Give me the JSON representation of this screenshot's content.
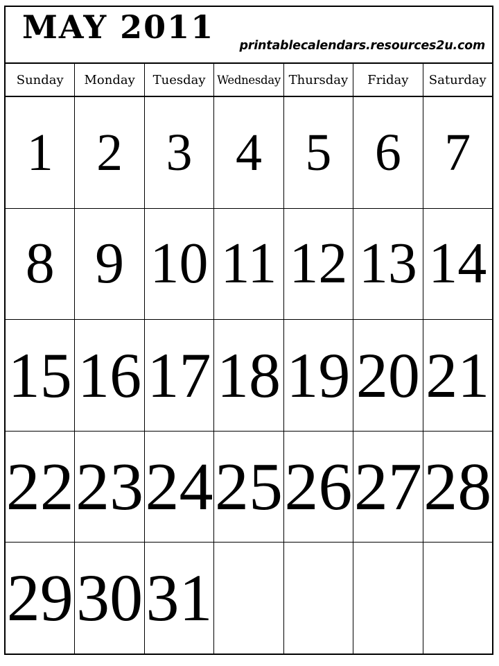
{
  "header": {
    "month_title": "MAY 2011",
    "site_url": "printablecalendars.resources2u.com"
  },
  "weekdays": [
    {
      "label": "Sunday"
    },
    {
      "label": "Monday"
    },
    {
      "label": "Tuesday"
    },
    {
      "label": "Wednesday"
    },
    {
      "label": "Thursday"
    },
    {
      "label": "Friday"
    },
    {
      "label": "Saturday"
    }
  ],
  "weeks": [
    {
      "days": [
        {
          "number": "1"
        },
        {
          "number": "2"
        },
        {
          "number": "3"
        },
        {
          "number": "4"
        },
        {
          "number": "5"
        },
        {
          "number": "6"
        },
        {
          "number": "7"
        }
      ]
    },
    {
      "days": [
        {
          "number": "8"
        },
        {
          "number": "9"
        },
        {
          "number": "10"
        },
        {
          "number": "11"
        },
        {
          "number": "12"
        },
        {
          "number": "13"
        },
        {
          "number": "14"
        }
      ]
    },
    {
      "days": [
        {
          "number": "15"
        },
        {
          "number": "16"
        },
        {
          "number": "17"
        },
        {
          "number": "18"
        },
        {
          "number": "19"
        },
        {
          "number": "20"
        },
        {
          "number": "21"
        }
      ]
    },
    {
      "days": [
        {
          "number": "22"
        },
        {
          "number": "23"
        },
        {
          "number": "24"
        },
        {
          "number": "25"
        },
        {
          "number": "26"
        },
        {
          "number": "27"
        },
        {
          "number": "28"
        }
      ]
    },
    {
      "days": [
        {
          "number": "29"
        },
        {
          "number": "30"
        },
        {
          "number": "31"
        },
        {
          "number": ""
        },
        {
          "number": ""
        },
        {
          "number": ""
        },
        {
          "number": ""
        }
      ]
    }
  ],
  "colors": {
    "ink": "#000000",
    "paper": "#ffffff"
  }
}
